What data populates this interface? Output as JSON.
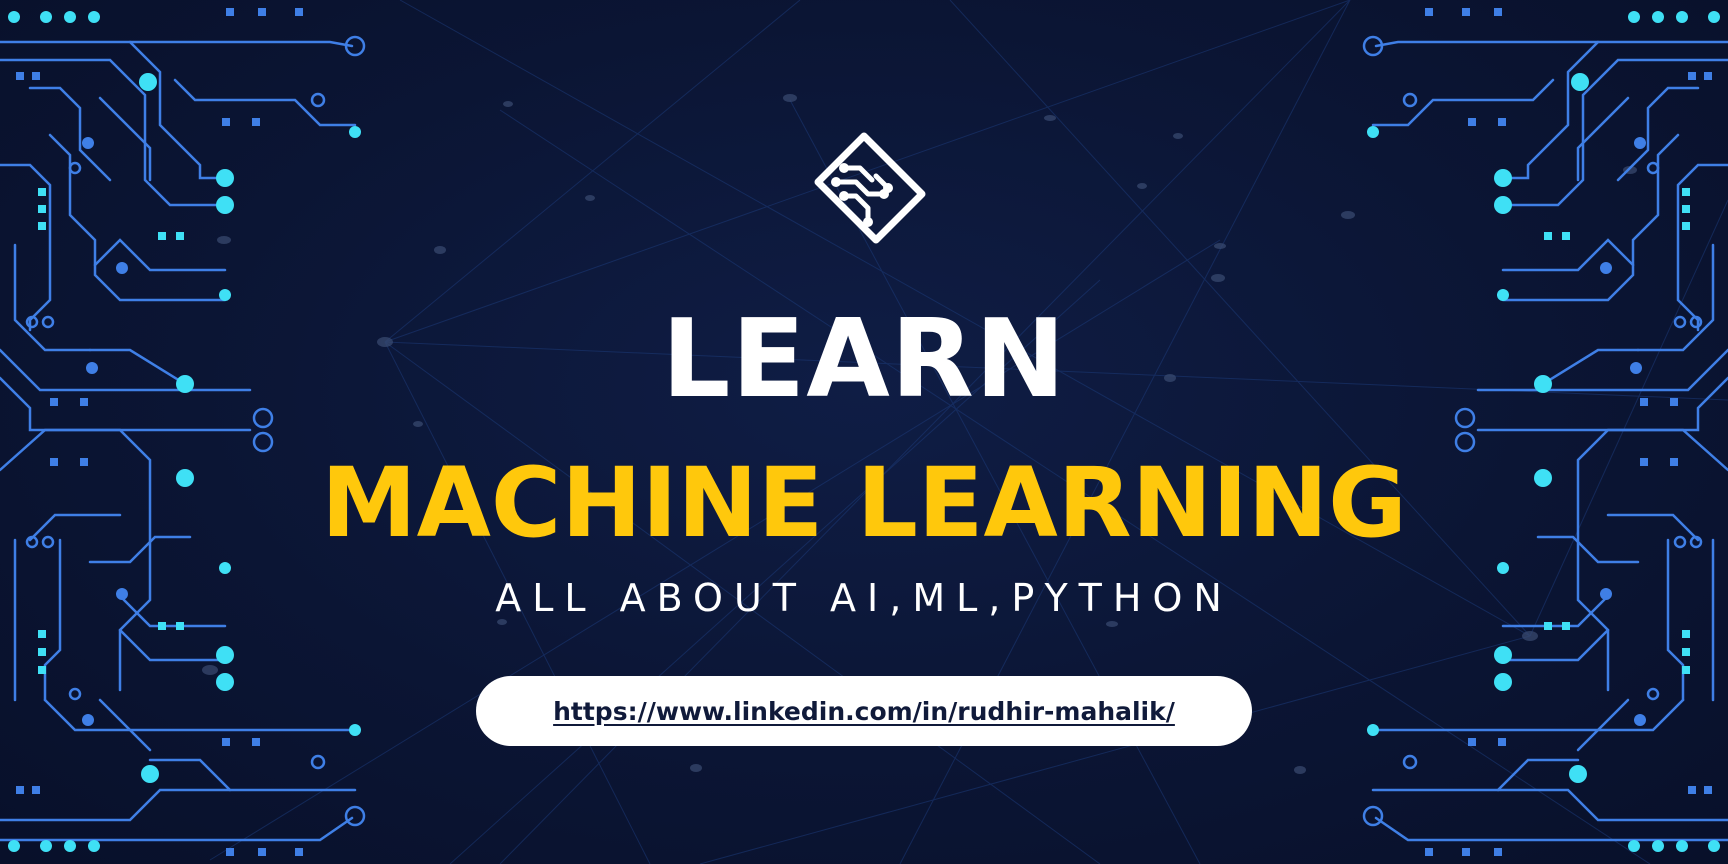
{
  "banner": {
    "title_line1": "LEARN",
    "title_line2": "MACHINE LEARNING",
    "tagline": "ALL ABOUT AI,ML,PYTHON",
    "url": "https://www.linkedin.com/in/rudhir-mahalik/"
  },
  "logo": {
    "icon": "circuit-chip-logo"
  },
  "decor": {
    "left_icon": "circuit-board-pattern",
    "right_icon": "circuit-board-pattern"
  },
  "colors": {
    "background": "#0b1534",
    "accent_yellow": "#ffc80c",
    "text_white": "#ffffff",
    "circuit_line": "#3f7fe6",
    "circuit_node": "#3fe0f5"
  }
}
